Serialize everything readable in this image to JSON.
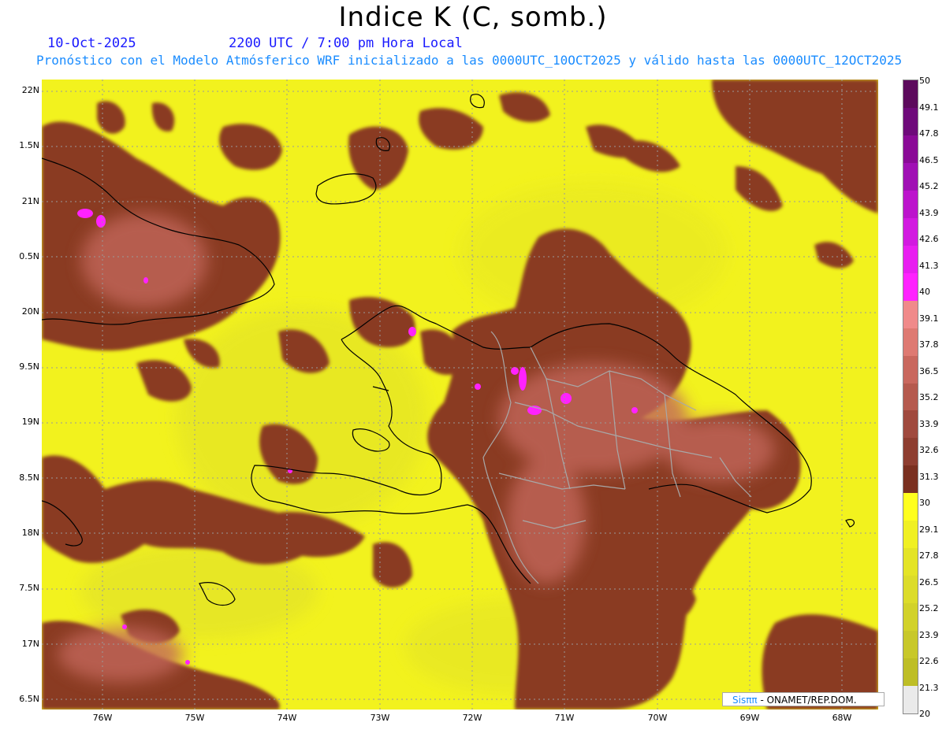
{
  "title": "Indice K (C, somb.)",
  "date": "10-Oct-2025",
  "valid_time": "2200 UTC / 7:00 pm Hora Local",
  "subtitle": "Pronóstico con el Modelo Atmósferico WRF inicializado a las 0000UTC_10OCT2025 y válido hasta las  0000UTC_12OCT2025",
  "credit_brand": "Sisππ",
  "credit_org": " - ONAMET/REP.DOM.",
  "lat_ticks": [
    "22N",
    "1.5N",
    "21N",
    "0.5N",
    "20N",
    "9.5N",
    "19N",
    "8.5N",
    "18N",
    "7.5N",
    "17N",
    "6.5N"
  ],
  "lon_ticks": [
    "76W",
    "75W",
    "74W",
    "73W",
    "72W",
    "71W",
    "70W",
    "69W",
    "68W"
  ],
  "colorbar": {
    "labels": [
      "50",
      "49.1",
      "47.8",
      "46.5",
      "45.2",
      "43.9",
      "42.6",
      "41.3",
      "40",
      "39.1",
      "37.8",
      "36.5",
      "35.2",
      "33.9",
      "32.6",
      "31.3",
      "30",
      "29.1",
      "27.8",
      "26.5",
      "25.2",
      "23.9",
      "22.6",
      "21.3",
      "20"
    ],
    "colors": [
      "#5c0a5c",
      "#6e0a7a",
      "#8a0a96",
      "#a010b4",
      "#bc14cc",
      "#d21ae0",
      "#e81ef0",
      "#ff22ff",
      "#f08a8a",
      "#de7a72",
      "#c9685e",
      "#b55a4e",
      "#a04a3e",
      "#8e3e30",
      "#7a3020",
      "#ffff1e",
      "#f0f022",
      "#e4e426",
      "#dcdc2a",
      "#d2d22a",
      "#c8c82a",
      "#bebe26",
      "#eaeaea"
    ]
  },
  "colors": {
    "background_field": "#ffff1e",
    "moist_field": "#8a3b22",
    "very_moist_field": "#ff22ff",
    "coast": "#000000",
    "borders": "#9a9a9a"
  }
}
